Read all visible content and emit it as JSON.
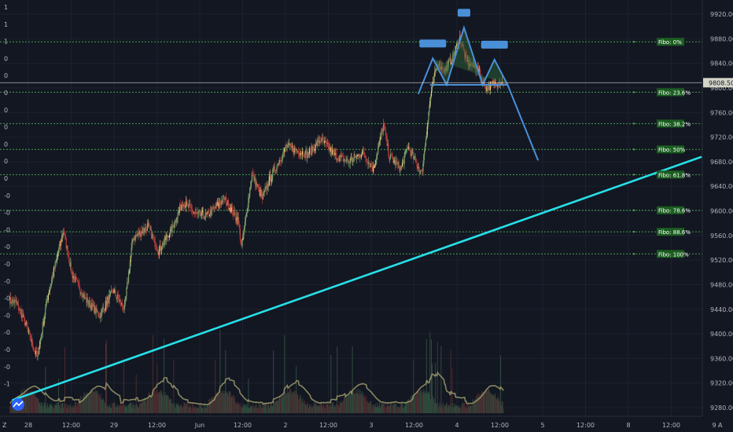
{
  "chart_data": {
    "type": "candlestick",
    "price_axis": {
      "ticks": [
        "9920.00",
        "9880.00",
        "9840.00",
        "9800.00",
        "9760.00",
        "9720.00",
        "9680.00",
        "9640.00",
        "9600.00",
        "9560.00",
        "9520.00",
        "9480.00",
        "9440.00",
        "9400.00",
        "9360.00",
        "9320.00",
        "9280.00"
      ],
      "ylim": [
        9270,
        9935
      ]
    },
    "time_axis": {
      "ticks": [
        "28",
        "12:00",
        "29",
        "12:00",
        "Jun",
        "12:00",
        "2",
        "12:00",
        "3",
        "12:00",
        "4",
        "12:00",
        "5",
        "12:00",
        "8",
        "12:00",
        "9"
      ]
    },
    "left_axis": {
      "ticks": [
        "1",
        "1",
        "1",
        "0",
        "0",
        "0",
        "0",
        "0",
        "0",
        "0",
        "0",
        "-0",
        "-0",
        "-0",
        "-0",
        "-0",
        "-0",
        "-0",
        "-0",
        "-0",
        "-0",
        "-0",
        "-1"
      ]
    },
    "current_price": {
      "label": "9808.50",
      "value": 9808.5
    },
    "fibonacci": {
      "color": "#4caf50",
      "levels": [
        {
          "label": "Fibo:  0%",
          "price": 9875
        },
        {
          "label": "Fibo: 23.6%",
          "price": 9793
        },
        {
          "label": "Fibo: 38.2%",
          "price": 9742
        },
        {
          "label": "Fibo:  50%",
          "price": 9700
        },
        {
          "label": "Fibo: 61.8%",
          "price": 9659
        },
        {
          "label": "Fibo: 78.6%",
          "price": 9601
        },
        {
          "label": "Fibo: 88.6%",
          "price": 9566
        },
        {
          "label": "Fibo: 100%",
          "price": 9530
        }
      ]
    },
    "trendline": {
      "color": "#26e0e8",
      "from": {
        "bar": 4,
        "price": 9292
      },
      "to": {
        "bar": 999,
        "price": 9688
      }
    },
    "pattern": {
      "type": "head-and-shoulders",
      "color": "#4a90d9",
      "points": [
        {
          "bar": 590,
          "price": 9790
        },
        {
          "bar": 611,
          "price": 9848
        },
        {
          "bar": 631,
          "price": 9805
        },
        {
          "bar": 656,
          "price": 9898
        },
        {
          "bar": 683,
          "price": 9805
        },
        {
          "bar": 700,
          "price": 9846
        },
        {
          "bar": 719,
          "price": 9805
        },
        {
          "bar": 763,
          "price": 9682
        }
      ],
      "neckline": {
        "from": {
          "bar": 607,
          "price": 9805
        },
        "to": {
          "bar": 719,
          "price": 9805
        }
      }
    },
    "ohlc_anchors": [
      [
        0,
        9455
      ],
      [
        10,
        9450
      ],
      [
        22,
        9420
      ],
      [
        40,
        9360
      ],
      [
        55,
        9460
      ],
      [
        78,
        9568
      ],
      [
        90,
        9498
      ],
      [
        110,
        9456
      ],
      [
        130,
        9430
      ],
      [
        150,
        9470
      ],
      [
        166,
        9440
      ],
      [
        178,
        9555
      ],
      [
        200,
        9575
      ],
      [
        215,
        9535
      ],
      [
        235,
        9572
      ],
      [
        250,
        9615
      ],
      [
        270,
        9594
      ],
      [
        285,
        9592
      ],
      [
        310,
        9620
      ],
      [
        330,
        9585
      ],
      [
        335,
        9540
      ],
      [
        350,
        9660
      ],
      [
        365,
        9620
      ],
      [
        375,
        9650
      ],
      [
        400,
        9705
      ],
      [
        430,
        9692
      ],
      [
        450,
        9716
      ],
      [
        470,
        9690
      ],
      [
        490,
        9680
      ],
      [
        510,
        9695
      ],
      [
        525,
        9668
      ],
      [
        540,
        9740
      ],
      [
        548,
        9690
      ],
      [
        565,
        9668
      ],
      [
        575,
        9705
      ],
      [
        595,
        9660
      ],
      [
        608,
        9788
      ],
      [
        618,
        9842
      ],
      [
        628,
        9828
      ],
      [
        640,
        9850
      ],
      [
        650,
        9882
      ],
      [
        660,
        9842
      ],
      [
        675,
        9832
      ],
      [
        688,
        9800
      ],
      [
        705,
        9810
      ],
      [
        713,
        9808
      ]
    ],
    "volume_hint": "low with periodic spikes near session opens",
    "grid": true,
    "legend": "none"
  },
  "ui": {
    "logo_icon": "tradingview-cloud-icon",
    "settings_icon": "gear-icon",
    "corner_left_label": "Z",
    "corner_right_label": "A",
    "colors": {
      "background": "#131722",
      "grid": "#1c2030",
      "candle_up": "#7fa36b",
      "candle_down": "#b73b38",
      "candle_up_alt": "#e8d87a",
      "volume_up": "#2f4a3d",
      "volume_down": "#4b2a2e",
      "ma_line": "#9c9a6a",
      "price_tag": "#d4d4c8"
    }
  }
}
